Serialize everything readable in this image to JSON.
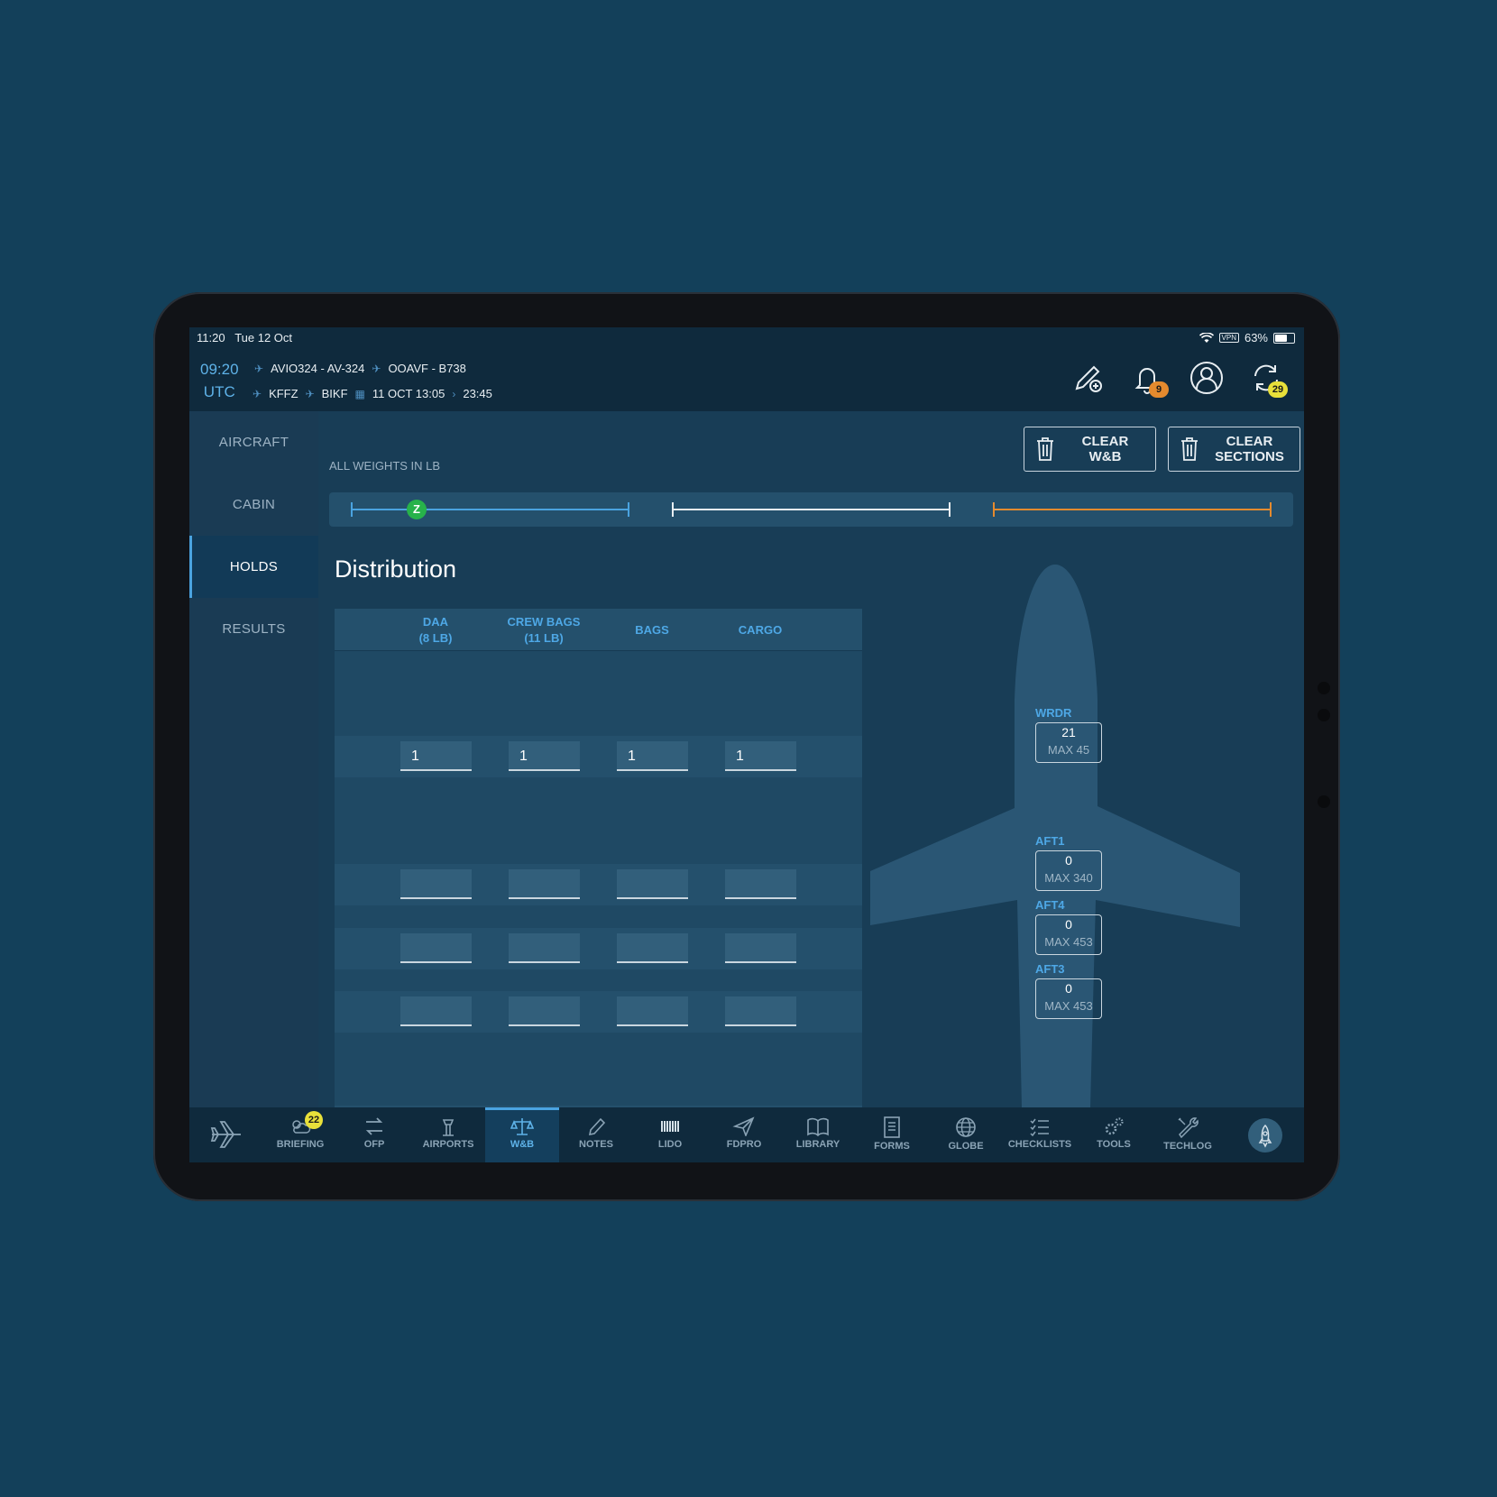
{
  "status_bar": {
    "time": "11:20",
    "date": "Tue 12 Oct",
    "vpn": "VPN",
    "battery": "63%",
    "battery_level": 0.63
  },
  "header": {
    "utc_time": "09:20",
    "utc_label": "UTC",
    "flight": "AVIO324 - AV-324",
    "aircraft": "OOAVF - B738",
    "origin": "KFFZ",
    "destination": "BIKF",
    "departure": "11 OCT 13:05",
    "duration": "23:45",
    "notifications_count": "9",
    "sync_count": "29"
  },
  "sidebar": {
    "items": [
      {
        "label": "AIRCRAFT"
      },
      {
        "label": "CABIN"
      },
      {
        "label": "HOLDS"
      },
      {
        "label": "RESULTS"
      }
    ],
    "active": "HOLDS"
  },
  "main": {
    "units_note": "ALL WEIGHTS IN LB",
    "clear_wb": "CLEAR W&B",
    "clear_wb_l1": "CLEAR",
    "clear_wb_l2": "W&B",
    "clear_sections_l1": "CLEAR",
    "clear_sections_l2": "SECTIONS",
    "limit_marker": "Z",
    "limit_colors": [
      "#4aa3e0",
      "#e8eef2",
      "#e48a2e"
    ],
    "section_title": "Distribution",
    "columns": [
      {
        "l1": "DAA",
        "l2": "(8 LB)"
      },
      {
        "l1": "CREW BAGS",
        "l2": "(11 LB)"
      },
      {
        "l1": "BAGS",
        "l2": ""
      },
      {
        "l1": "CARGO",
        "l2": ""
      }
    ],
    "rows": [
      {
        "values": [
          "1",
          "1",
          "1",
          "1"
        ]
      },
      {
        "values": [
          "",
          "",
          "",
          ""
        ]
      },
      {
        "values": [
          "",
          "",
          "",
          ""
        ]
      },
      {
        "values": [
          "",
          "",
          "",
          ""
        ]
      }
    ],
    "holds": [
      {
        "name": "WRDR",
        "value": "21",
        "max": "MAX 45"
      },
      {
        "name": "AFT1",
        "value": "0",
        "max": "MAX 340"
      },
      {
        "name": "AFT4",
        "value": "0",
        "max": "MAX 453"
      },
      {
        "name": "AFT3",
        "value": "0",
        "max": "MAX 453"
      }
    ]
  },
  "tabbar": {
    "items": [
      {
        "label": "",
        "icon": "airplane-icon"
      },
      {
        "label": "BRIEFING",
        "icon": "weather-icon",
        "badge": "22"
      },
      {
        "label": "OFP",
        "icon": "route-icon"
      },
      {
        "label": "AIRPORTS",
        "icon": "tower-icon"
      },
      {
        "label": "W&B",
        "icon": "scale-icon"
      },
      {
        "label": "NOTES",
        "icon": "pencil-icon"
      },
      {
        "label": "LIDO",
        "icon": "barcode-icon"
      },
      {
        "label": "FDPRO",
        "icon": "paper-plane-icon"
      },
      {
        "label": "LIBRARY",
        "icon": "book-icon"
      },
      {
        "label": "FORMS",
        "icon": "form-icon"
      },
      {
        "label": "GLOBE",
        "icon": "globe-icon"
      },
      {
        "label": "CHECKLISTS",
        "icon": "checklist-icon"
      },
      {
        "label": "TOOLS",
        "icon": "gears-icon"
      },
      {
        "label": "TECHLOG",
        "icon": "wrench-icon"
      },
      {
        "label": "",
        "icon": "rocket-icon"
      }
    ],
    "active": "W&B"
  }
}
